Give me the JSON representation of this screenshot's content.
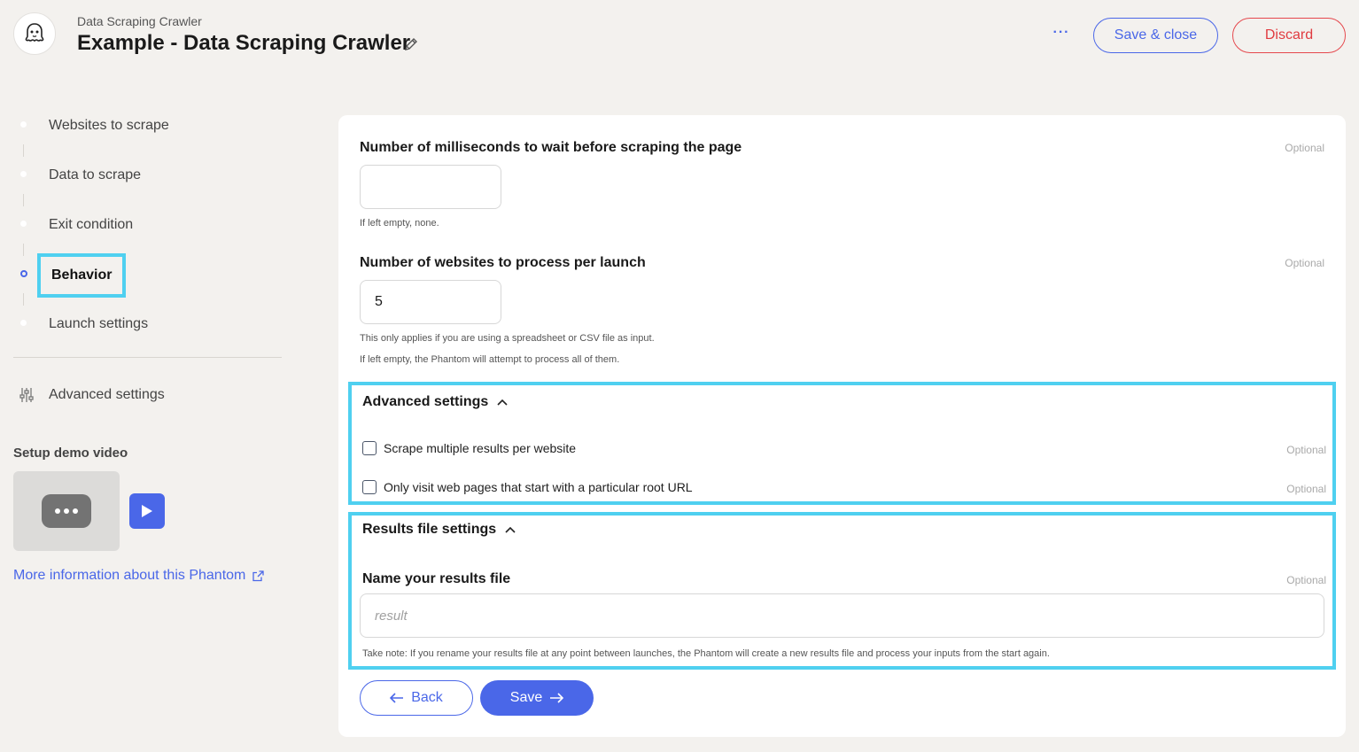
{
  "header": {
    "breadcrumb": "Data Scraping Crawler",
    "title": "Example - Data Scraping Crawler",
    "more_label": "···",
    "save_close_label": "Save & close",
    "discard_label": "Discard"
  },
  "sidebar": {
    "steps": [
      {
        "label": "Websites to scrape",
        "active": false
      },
      {
        "label": "Data to scrape",
        "active": false
      },
      {
        "label": "Exit condition",
        "active": false
      },
      {
        "label": "Behavior",
        "active": true
      },
      {
        "label": "Launch settings",
        "active": false
      }
    ],
    "advanced_label": "Advanced settings",
    "demo_title": "Setup demo video",
    "more_info_label": "More information about this Phantom"
  },
  "form": {
    "wait_ms": {
      "label": "Number of milliseconds to wait before scraping the page",
      "optional": "Optional",
      "value": "",
      "help": "If left empty, none."
    },
    "websites_per_launch": {
      "label": "Number of websites to process per launch",
      "optional": "Optional",
      "value": "5",
      "help1": "This only applies if you are using a spreadsheet or CSV file as input.",
      "help2": "If left empty, the Phantom will attempt to process all of them."
    },
    "advanced": {
      "title": "Advanced settings",
      "options": [
        {
          "label": "Scrape multiple results per website",
          "optional": "Optional",
          "checked": false
        },
        {
          "label": "Only visit web pages that start with a particular root URL",
          "optional": "Optional",
          "checked": false
        }
      ]
    },
    "results": {
      "title": "Results file settings",
      "name_label": "Name your results file",
      "optional": "Optional",
      "placeholder": "result",
      "note": "Take note: If you rename your results file at any point between launches, the Phantom will create a new results file and process your inputs from the start again."
    },
    "back_label": "Back",
    "save_label": "Save"
  },
  "colors": {
    "accent": "#4a67e8",
    "danger": "#e03b40",
    "highlight": "#4fd0f0",
    "background": "#f3f1ee"
  }
}
